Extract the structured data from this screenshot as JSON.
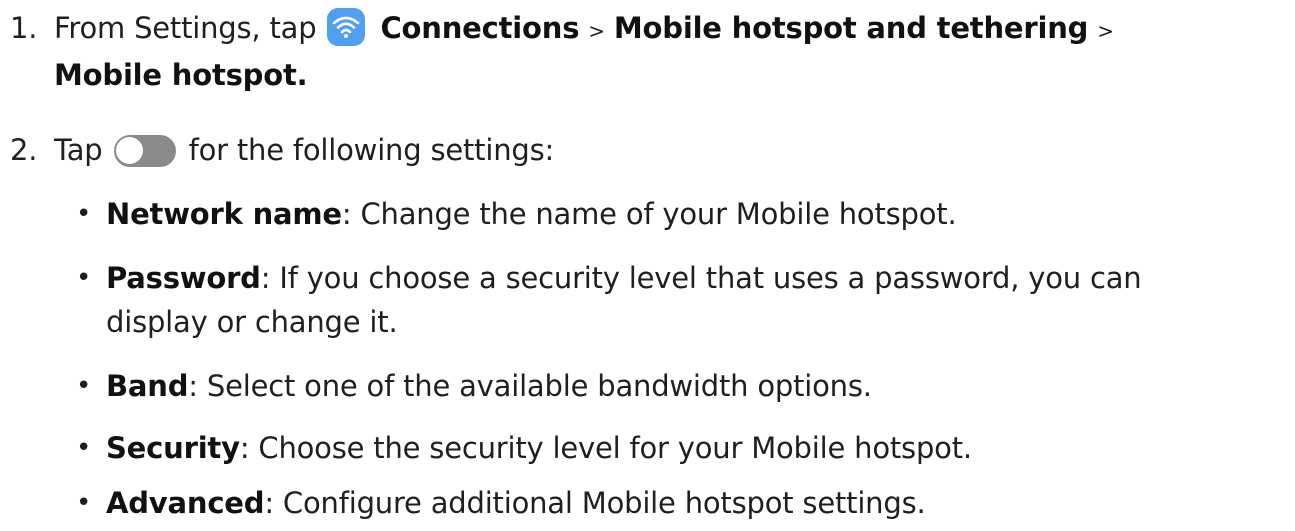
{
  "steps": [
    {
      "number": "1.",
      "prefix": "From Settings, tap",
      "connections": "Connections",
      "sep1": ">",
      "hotspot_tethering": "Mobile hotspot and tethering",
      "sep2": ">",
      "mobile_hotspot": "Mobile hotspot",
      "suffix": ".",
      "icon": "wifi-icon"
    },
    {
      "number": "2.",
      "prefix": "Tap",
      "suffix": "for the following settings:",
      "icon": "toggle-icon"
    }
  ],
  "bullets": [
    {
      "term": "Network name",
      "desc": ": Change the name of your Mobile hotspot."
    },
    {
      "term": "Password",
      "desc": ": If you choose a security level that uses a password, you can",
      "desc_cont": "display or change it."
    },
    {
      "term": "Band",
      "desc": ": Select one of the available bandwidth options."
    },
    {
      "term": "Security",
      "desc": ": Choose the security level for your Mobile hotspot."
    },
    {
      "term": "Advanced",
      "desc": ": Configure additional Mobile hotspot settings."
    }
  ],
  "bullet_char": "•",
  "colors": {
    "text": "#1f1f1f",
    "wifi_icon_bg": "#4fa0f0",
    "toggle": "#8a8a8a"
  }
}
